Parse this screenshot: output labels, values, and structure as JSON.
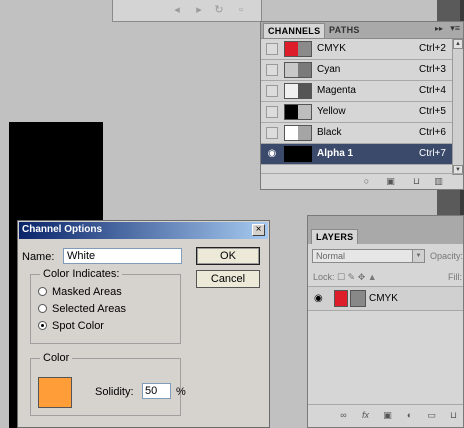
{
  "channels_panel": {
    "tabs": [
      "CHANNELS",
      "PATHS"
    ],
    "channels": [
      {
        "name": "CMYK",
        "shortcut": "Ctrl+2",
        "selected": false
      },
      {
        "name": "Cyan",
        "shortcut": "Ctrl+3",
        "selected": false
      },
      {
        "name": "Magenta",
        "shortcut": "Ctrl+4",
        "selected": false
      },
      {
        "name": "Yellow",
        "shortcut": "Ctrl+5",
        "selected": false
      },
      {
        "name": "Black",
        "shortcut": "Ctrl+6",
        "selected": false
      },
      {
        "name": "Alpha 1",
        "shortcut": "Ctrl+7",
        "selected": true
      }
    ]
  },
  "layers_panel": {
    "tab": "LAYERS",
    "blend_mode": "Normal",
    "opacity_label": "Opacity:",
    "lock_label": "Lock:",
    "fill_label": "Fill:",
    "layer": {
      "name": "CMYK"
    }
  },
  "dialog": {
    "title": "Channel Options",
    "close_glyph": "×",
    "name_label": "Name:",
    "name_value": "White",
    "ok_label": "OK",
    "cancel_label": "Cancel",
    "color_indicates": {
      "legend": "Color Indicates:",
      "options": [
        "Masked Areas",
        "Selected Areas",
        "Spot Color"
      ],
      "selected": "Spot Color"
    },
    "color": {
      "legend": "Color",
      "swatch_hex": "#ff9d38",
      "solidity_label": "Solidity:",
      "solidity_value": "50",
      "percent": "%"
    }
  },
  "colors": {
    "selected_row": "#3b4a6b",
    "cmyk_red": "#dd1e2a",
    "titlebar": "#0a246a"
  }
}
